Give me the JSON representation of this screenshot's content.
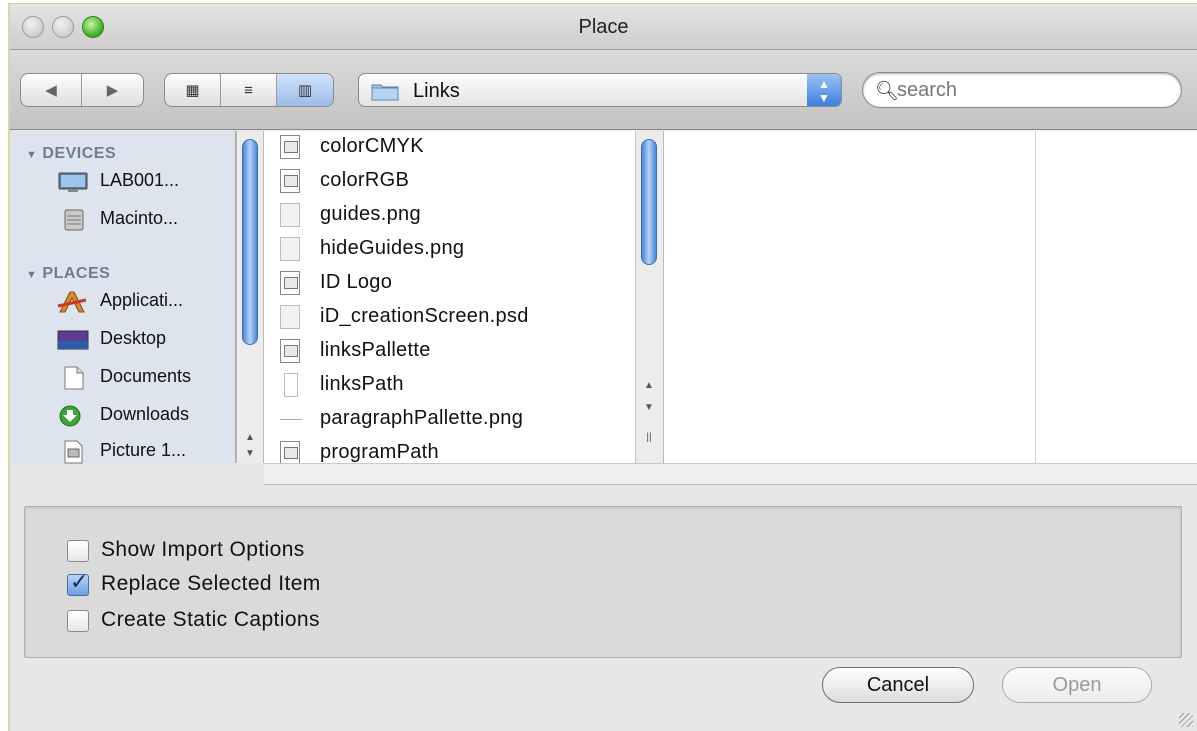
{
  "window": {
    "title": "Place"
  },
  "toolbar": {
    "back_icon": "◀",
    "forward_icon": "▶",
    "view_icons": [
      "▦",
      "≡",
      "▥"
    ],
    "path_label": "Links",
    "search_placeholder": "search"
  },
  "sidebar": {
    "devices_header": "DEVICES",
    "devices": [
      {
        "label": "LAB001...",
        "icon": "computer-icon"
      },
      {
        "label": "Macinto...",
        "icon": "hard-drive-icon"
      }
    ],
    "places_header": "PLACES",
    "places": [
      {
        "label": "Applicati...",
        "icon": "applications-icon"
      },
      {
        "label": "Desktop",
        "icon": "desktop-icon"
      },
      {
        "label": "Documents",
        "icon": "documents-icon"
      },
      {
        "label": "Downloads",
        "icon": "downloads-icon"
      },
      {
        "label": "Picture 1...",
        "icon": "picture-icon"
      }
    ]
  },
  "files": [
    {
      "name": "colorCMYK",
      "icon": "doc"
    },
    {
      "name": "colorRGB",
      "icon": "doc"
    },
    {
      "name": "guides.png",
      "icon": "img"
    },
    {
      "name": "hideGuides.png",
      "icon": "img"
    },
    {
      "name": "ID Logo",
      "icon": "doc"
    },
    {
      "name": "iD_creationScreen.psd",
      "icon": "img"
    },
    {
      "name": "linksPallette",
      "icon": "doc"
    },
    {
      "name": "linksPath",
      "icon": "path"
    },
    {
      "name": "paragraphPallette.png",
      "icon": "dash"
    },
    {
      "name": "programPath",
      "icon": "doc"
    }
  ],
  "options": {
    "show_import": {
      "label": "Show Import Options",
      "checked": false
    },
    "replace_selected": {
      "label": "Replace Selected Item",
      "checked": true
    },
    "static_captions": {
      "label": "Create Static Captions",
      "checked": false
    }
  },
  "buttons": {
    "cancel": "Cancel",
    "open": "Open"
  },
  "colors": {
    "sidebar_bg": "#dde4ee",
    "accent": "#4b86d6",
    "header_text": "#6f7d8f"
  }
}
